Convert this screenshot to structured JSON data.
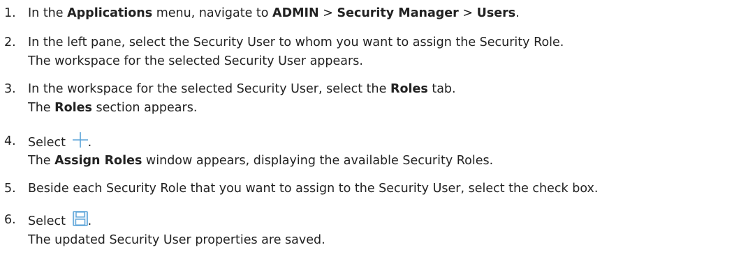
{
  "steps": [
    {
      "num": "1.",
      "line1": {
        "t1": "In the ",
        "b1": "Applications",
        "t2": " menu, navigate to ",
        "b2": "ADMIN",
        "t3": " > ",
        "b3": "Security Manager",
        "t4": " > ",
        "b4": "Users",
        "t5": "."
      }
    },
    {
      "num": "2.",
      "line1": "In the left pane, select the Security User to whom you want to assign the Security Role.",
      "line2": "The workspace for the selected Security User appears."
    },
    {
      "num": "3.",
      "line1": {
        "t1": "In the workspace for the selected Security User, select the ",
        "b1": "Roles",
        "t2": " tab."
      },
      "line2": {
        "t1": "The ",
        "b1": "Roles",
        "t2": " section appears."
      }
    },
    {
      "num": "4.",
      "line1": {
        "t1": "Select ",
        "icon": "plus-icon",
        "t2": "."
      },
      "line2": {
        "t1": "The ",
        "b1": "Assign Roles",
        "t2": " window appears, displaying the available Security Roles."
      }
    },
    {
      "num": "5.",
      "line1": "Beside each Security Role that you want to assign to the Security User, select the check box."
    },
    {
      "num": "6.",
      "line1": {
        "t1": "Select ",
        "icon": "save-icon",
        "t2": "."
      },
      "line2": "The updated Security User properties are saved."
    }
  ],
  "colors": {
    "text": "#222222",
    "icon_blue": "#5aa3d8"
  }
}
